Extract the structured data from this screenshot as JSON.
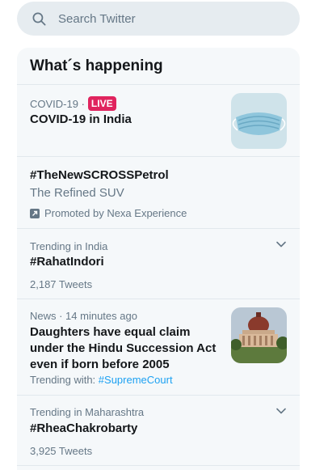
{
  "search": {
    "placeholder": "Search Twitter",
    "value": ""
  },
  "trends_panel": {
    "title": "What´s happening",
    "items": [
      {
        "meta": "COVID-19 ·",
        "badge": "LIVE",
        "title": "COVID-19 in India",
        "image": "face-mask-photo"
      },
      {
        "title": "#TheNewSCROSSPetrol",
        "description": "The Refined SUV",
        "promoted": "Promoted by Nexa Experience"
      },
      {
        "meta": "Trending in India",
        "title": "#RahatIndori",
        "count": "2,187 Tweets"
      },
      {
        "meta": "News · 14 minutes ago",
        "title": "Daughters have equal claim under the Hindu Succession Act even if born before 2005",
        "trending_with_label": "Trending with:",
        "trending_with_tag": "#SupremeCourt",
        "image": "supreme-court-photo"
      },
      {
        "meta": "Trending in Maharashtra",
        "title": "#RheaChakrobarty",
        "count": "3,925 Tweets"
      }
    ]
  },
  "colors": {
    "live": "#e0245e",
    "link": "#1da1f2",
    "panel_bg": "#f5f8fa",
    "search_bg": "#e6ecf0"
  }
}
